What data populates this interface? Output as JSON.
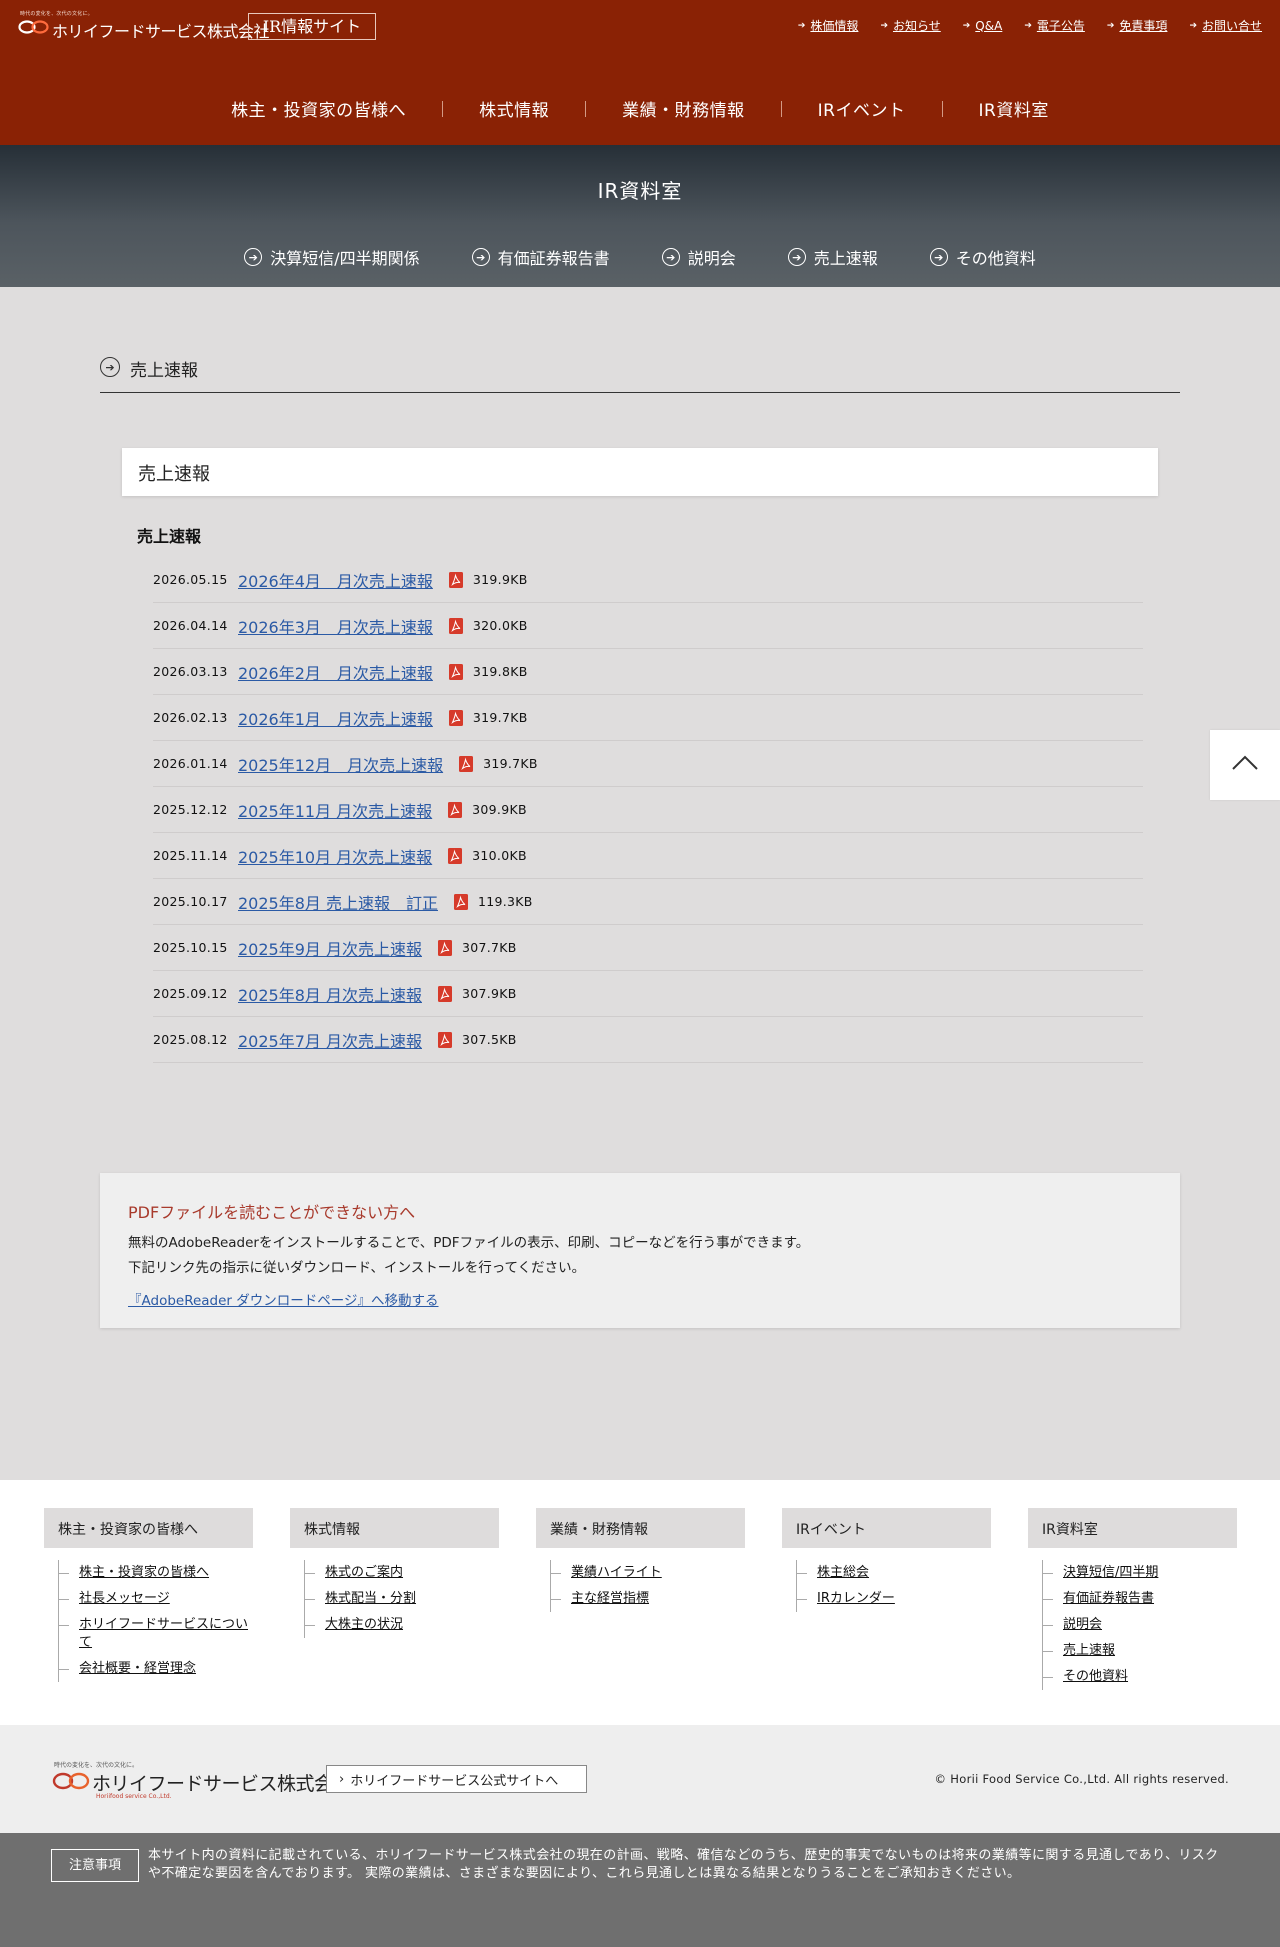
{
  "header": {
    "logo_tagline": "時代の変化を、次代の文化に。",
    "logo_name": "ホリイフードサービス株式会社",
    "ir_badge": "IR情報サイト",
    "util_links": [
      "株価情報",
      "お知らせ",
      "Q&A",
      "電子公告",
      "免責事項",
      "お問い合せ"
    ],
    "main_nav": [
      "株主・投資家の皆様へ",
      "株式情報",
      "業績・財務情報",
      "IRイベント",
      "IR資料室"
    ]
  },
  "hero": {
    "title": "IR資料室",
    "sub_nav": [
      "決算短信/四半期関係",
      "有価証券報告書",
      "説明会",
      "売上速報",
      "その他資料"
    ]
  },
  "section": {
    "heading": "売上速報",
    "card_title": "売上速報",
    "list_title": "売上速報",
    "items": [
      {
        "date": "2026.05.15",
        "title": "2026年4月　月次売上速報",
        "size": "319.9KB"
      },
      {
        "date": "2026.04.14",
        "title": "2026年3月　月次売上速報",
        "size": "320.0KB"
      },
      {
        "date": "2026.03.13",
        "title": "2026年2月　月次売上速報",
        "size": "319.8KB"
      },
      {
        "date": "2026.02.13",
        "title": "2026年1月　月次売上速報",
        "size": "319.7KB"
      },
      {
        "date": "2026.01.14",
        "title": "2025年12月　月次売上速報",
        "size": "319.7KB"
      },
      {
        "date": "2025.12.12",
        "title": "2025年11月 月次売上速報",
        "size": "309.9KB"
      },
      {
        "date": "2025.11.14",
        "title": "2025年10月 月次売上速報",
        "size": "310.0KB"
      },
      {
        "date": "2025.10.17",
        "title": "2025年8月 売上速報　訂正",
        "size": "119.3KB"
      },
      {
        "date": "2025.10.15",
        "title": "2025年9月 月次売上速報",
        "size": "307.7KB"
      },
      {
        "date": "2025.09.12",
        "title": "2025年8月 月次売上速報",
        "size": "307.9KB"
      },
      {
        "date": "2025.08.12",
        "title": "2025年7月 月次売上速報",
        "size": "307.5KB"
      }
    ]
  },
  "pdf_notice": {
    "title": "PDFファイルを読むことができない方へ",
    "line1": "無料のAdobeReaderをインストールすることで、PDFファイルの表示、印刷、コピーなどを行う事ができます。",
    "line2": "下記リンク先の指示に従いダウンロード、インストールを行ってください。",
    "link": "『AdobeReader ダウンロードページ』へ移動する"
  },
  "footer": {
    "columns": [
      {
        "title": "株主・投資家の皆様へ",
        "links": [
          "株主・投資家の皆様へ",
          "社長メッセージ",
          "ホリイフードサービスについて",
          "会社概要・経営理念"
        ]
      },
      {
        "title": "株式情報",
        "links": [
          "株式のご案内",
          "株式配当・分割",
          "大株主の状況"
        ]
      },
      {
        "title": "業績・財務情報",
        "links": [
          "業績ハイライト",
          "主な経営指標"
        ]
      },
      {
        "title": "IRイベント",
        "links": [
          "株主総会",
          "IRカレンダー"
        ]
      },
      {
        "title": "IR資料室",
        "links": [
          "決算短信/四半期",
          "有価証券報告書",
          "説明会",
          "売上速報",
          "その他資料"
        ]
      }
    ],
    "brand_tagline": "時代の変化を、次代の文化に。",
    "brand_name": "ホリイフードサービス株式会社",
    "brand_en": "Horiifood service Co.,Ltd.",
    "site_button": "ホリイフードサービス公式サイトへ",
    "copyright": "© Horii Food Service Co.,Ltd. All rights reserved.",
    "disclaimer_label": "注意事項",
    "disclaimer_text": "本サイト内の資料に記載されている、ホリイフードサービス株式会社の現在の計画、戦略、確信などのうち、歴史的事実でないものは将来の業績等に関する見通しであり、リスクや不確定な要因を含んでおります。 実際の業績は、さまざまな要因により、これら見通しとは異なる結果となりうることをご承知おきください。"
  },
  "colors": {
    "header_bg": "#8a2205",
    "link": "#2b5aa5",
    "accent_red": "#a83a2c",
    "page_bg": "#dfdddd"
  }
}
